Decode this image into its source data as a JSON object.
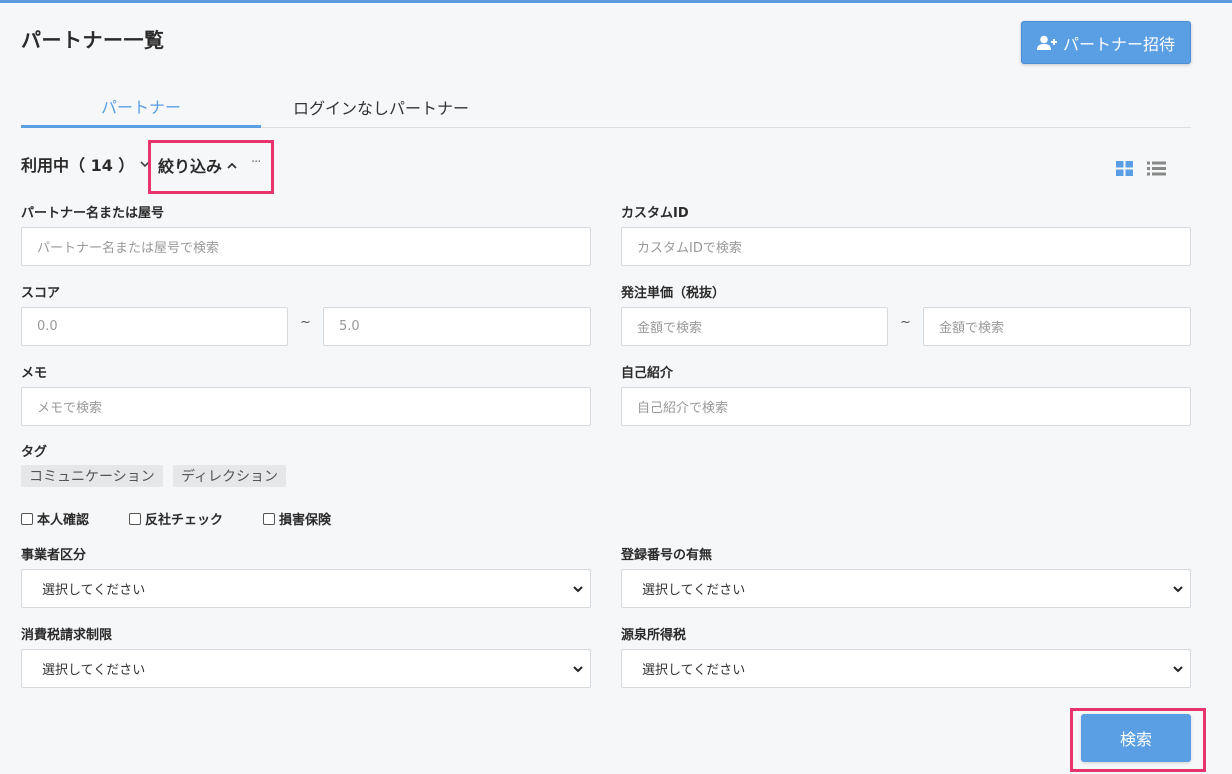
{
  "header": {
    "title": "パートナー一覧",
    "invite_label": "パートナー招待"
  },
  "tabs": [
    {
      "label": "パートナー",
      "active": true
    },
    {
      "label": "ログインなしパートナー",
      "active": false
    }
  ],
  "filterbar": {
    "status_label": "利用中（ 14 ）",
    "narrow_label": "絞り込み",
    "more_label": "···"
  },
  "form": {
    "partner_name": {
      "label": "パートナー名または屋号",
      "placeholder": "パートナー名または屋号で検索"
    },
    "custom_id": {
      "label": "カスタムID",
      "placeholder": "カスタムIDで検索"
    },
    "score": {
      "label": "スコア",
      "min_placeholder": "0.0",
      "max_placeholder": "5.0"
    },
    "order_price": {
      "label": "発注単価（税抜）",
      "min_placeholder": "金額で検索",
      "max_placeholder": "金額で検索"
    },
    "tilde": "~",
    "memo": {
      "label": "メモ",
      "placeholder": "メモで検索"
    },
    "intro": {
      "label": "自己紹介",
      "placeholder": "自己紹介で検索"
    },
    "tags": {
      "label": "タグ",
      "items": [
        "コミュニケーション",
        "ディレクション"
      ]
    },
    "checks": [
      "本人確認",
      "反社チェック",
      "損害保険"
    ],
    "business_type": {
      "label": "事業者区分",
      "value": "選択してください"
    },
    "registration": {
      "label": "登録番号の有無",
      "value": "選択してください"
    },
    "tax_limit": {
      "label": "消費税請求制限",
      "value": "選択してください"
    },
    "withholding": {
      "label": "源泉所得税",
      "value": "選択してください"
    }
  },
  "search_label": "検索",
  "colors": {
    "accent": "#5a9ee3",
    "highlight": "#e8346d"
  }
}
